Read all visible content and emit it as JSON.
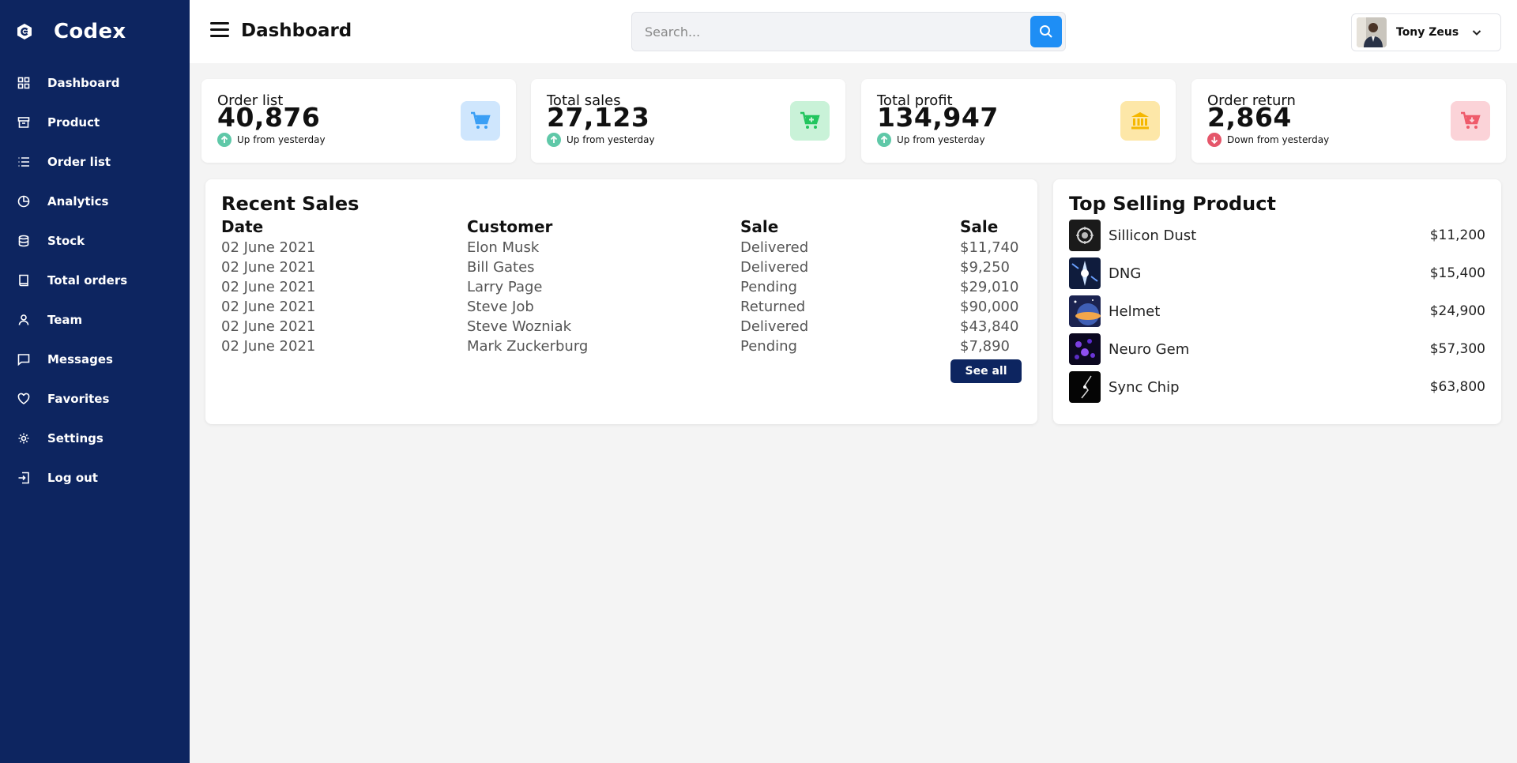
{
  "sidebar": {
    "brand": "Codex",
    "items": [
      {
        "label": "Dashboard",
        "icon": "grid-icon"
      },
      {
        "label": "Product",
        "icon": "archive-icon"
      },
      {
        "label": "Order list",
        "icon": "list-icon"
      },
      {
        "label": "Analytics",
        "icon": "pie-chart-icon"
      },
      {
        "label": "Stock",
        "icon": "database-icon"
      },
      {
        "label": "Total orders",
        "icon": "book-icon"
      },
      {
        "label": "Team",
        "icon": "user-icon"
      },
      {
        "label": "Messages",
        "icon": "message-icon"
      },
      {
        "label": "Favorites",
        "icon": "heart-icon"
      },
      {
        "label": "Settings",
        "icon": "gear-icon"
      },
      {
        "label": "Log out",
        "icon": "logout-icon"
      }
    ]
  },
  "header": {
    "title": "Dashboard",
    "search_placeholder": "Search...",
    "user_name": "Tony Zeus"
  },
  "stats": [
    {
      "label": "Order list",
      "value": "40,876",
      "trend": "Up from yesterday",
      "direction": "up",
      "icon": "cart-icon",
      "icon_color": "#3b9ff5",
      "bg_color": "#cfe6fd"
    },
    {
      "label": "Total sales",
      "value": "27,123",
      "trend": "Up from yesterday",
      "direction": "up",
      "icon": "cart-plus-icon",
      "icon_color": "#22c55e",
      "bg_color": "#c9f2d8"
    },
    {
      "label": "Total profit",
      "value": "134,947",
      "trend": "Up from yesterday",
      "direction": "up",
      "icon": "bank-icon",
      "icon_color": "#f5b700",
      "bg_color": "#fde7a8"
    },
    {
      "label": "Order return",
      "value": "2,864",
      "trend": "Down from yesterday",
      "direction": "down",
      "icon": "cart-down-icon",
      "icon_color": "#ef5b6b",
      "bg_color": "#fbd3d8"
    }
  ],
  "recent_sales": {
    "title": "Recent Sales",
    "headers": [
      "Date",
      "Customer",
      "Sale",
      "Sale"
    ],
    "rows": [
      [
        "02 June 2021",
        "Elon Musk",
        "Delivered",
        "$11,740"
      ],
      [
        "02 June 2021",
        "Bill Gates",
        "Delivered",
        "$9,250"
      ],
      [
        "02 June 2021",
        "Larry Page",
        "Pending",
        "$29,010"
      ],
      [
        "02 June 2021",
        "Steve Job",
        "Returned",
        "$90,000"
      ],
      [
        "02 June 2021",
        "Steve Wozniak",
        "Delivered",
        "$43,840"
      ],
      [
        "02 June 2021",
        "Mark Zuckerburg",
        "Pending",
        "$7,890"
      ]
    ],
    "see_all": "See all"
  },
  "top_selling": {
    "title": "Top Selling Product",
    "products": [
      {
        "name": "Sillicon Dust",
        "price": "$11,200"
      },
      {
        "name": "DNG",
        "price": "$15,400"
      },
      {
        "name": "Helmet",
        "price": "$24,900"
      },
      {
        "name": "Neuro Gem",
        "price": "$57,300"
      },
      {
        "name": "Sync Chip",
        "price": "$63,800"
      }
    ]
  },
  "colors": {
    "sidebar_bg": "#0d2560",
    "accent": "#1e8ef5",
    "trend_up": "#5fc8a8",
    "trend_down": "#e5566a"
  }
}
